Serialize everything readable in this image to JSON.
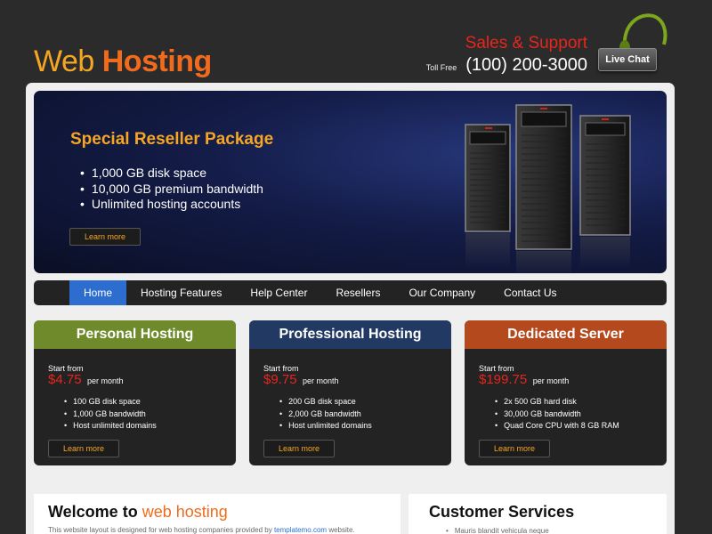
{
  "header": {
    "logo_part1": "Web",
    "logo_part2": "Hosting",
    "support_title": "Sales & Support",
    "toll_free_label": "Toll Free",
    "phone": "(100) 200-3000",
    "live_chat_label": "Live Chat",
    "headset_icon": "headset-icon"
  },
  "banner": {
    "title": "Special Reseller Package",
    "features": [
      "1,000 GB disk space",
      "10,000 GB premium bandwidth",
      "Unlimited hosting accounts"
    ],
    "button_label": "Learn more",
    "image_icon": "server-rack-icon"
  },
  "nav": {
    "items": [
      "Home",
      "Hosting Features",
      "Help Center",
      "Resellers",
      "Our Company",
      "Contact Us"
    ],
    "active": "Home"
  },
  "plans": [
    {
      "name": "Personal Hosting",
      "header_color": "#6f8a2a",
      "start_label": "Start from",
      "price": "$4.75",
      "period": "per month",
      "features": [
        "100 GB disk space",
        "1,000 GB bandwidth",
        "Host unlimited domains"
      ],
      "button_label": "Learn more"
    },
    {
      "name": "Professional Hosting",
      "header_color": "#223a63",
      "start_label": "Start from",
      "price": "$9.75",
      "period": "per month",
      "features": [
        "200 GB disk space",
        "2,000 GB bandwidth",
        "Host unlimited domains"
      ],
      "button_label": "Learn more"
    },
    {
      "name": "Dedicated Server",
      "header_color": "#b4491d",
      "start_label": "Start from",
      "price": "$199.75",
      "period": "per month",
      "features": [
        "2x 500 GB hard disk",
        "30,000 GB bandwidth",
        "Quad Core CPU with 8 GB RAM"
      ],
      "button_label": "Learn more"
    }
  ],
  "welcome": {
    "title_part1": "Welcome to",
    "title_part2": "web hosting",
    "text_part1": "This website layout is designed for web hosting companies provided by",
    "link": "templatemo.com",
    "text_part2": "website."
  },
  "customer_services": {
    "title": "Customer Services",
    "items": [
      "Mauris blandit vehicula neque"
    ]
  },
  "colors": {
    "accent_orange": "#f26b1d",
    "accent_yellow": "#f5a623",
    "price_red": "#e8251c",
    "nav_active": "#2e6dd0"
  }
}
